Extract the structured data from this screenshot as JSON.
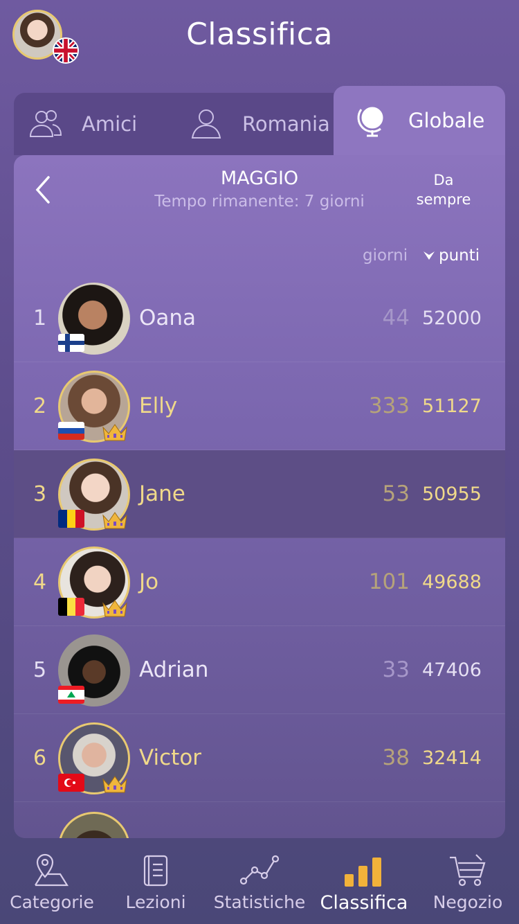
{
  "header": {
    "title": "Classifica"
  },
  "tabs": [
    {
      "label": "Amici",
      "icon": "friends-icon"
    },
    {
      "label": "Romania",
      "icon": "person-icon"
    },
    {
      "label": "Globale",
      "icon": "globe-icon",
      "selected": true
    }
  ],
  "period": {
    "month": "MAGGIO",
    "remaining": "Tempo rimanente: 7 giorni",
    "all_time": "Da sempre"
  },
  "columns": {
    "days": "giorni",
    "points": "punti",
    "sort": "punti"
  },
  "rows": [
    {
      "rank": "1",
      "name": "Oana",
      "days": "44",
      "points": "52000",
      "flag": "Finland",
      "crown": false
    },
    {
      "rank": "2",
      "name": "Elly",
      "days": "333",
      "points": "51127",
      "flag": "Russia",
      "crown": true
    },
    {
      "rank": "3",
      "name": "Jane",
      "days": "53",
      "points": "50955",
      "flag": "Romania",
      "crown": true,
      "current_user": true
    },
    {
      "rank": "4",
      "name": "Jo",
      "days": "101",
      "points": "49688",
      "flag": "Belgium",
      "crown": true
    },
    {
      "rank": "5",
      "name": "Adrian",
      "days": "33",
      "points": "47406",
      "flag": "Lebanon",
      "crown": false
    },
    {
      "rank": "6",
      "name": "Victor",
      "days": "38",
      "points": "32414",
      "flag": "Turkey",
      "crown": true
    }
  ],
  "tabbar": [
    {
      "label": "Categorie",
      "icon": "map-pin-icon"
    },
    {
      "label": "Lezioni",
      "icon": "book-icon"
    },
    {
      "label": "Statistiche",
      "icon": "line-chart-icon"
    },
    {
      "label": "Classifica",
      "icon": "bar-chart-icon",
      "active": true
    },
    {
      "label": "Negozio",
      "icon": "cart-icon"
    }
  ],
  "colors": {
    "gold": "#f0d98a",
    "accent": "#8e76c0",
    "active_icon": "#f2b23a"
  }
}
